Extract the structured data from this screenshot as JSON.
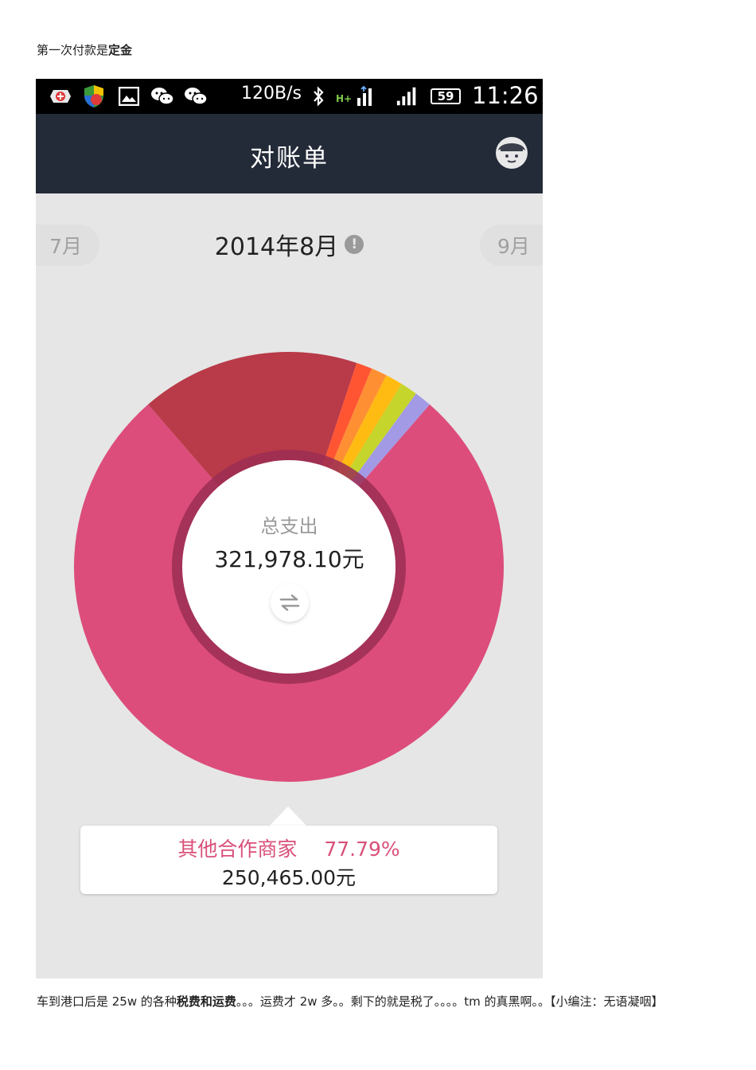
{
  "intro": {
    "text": "第一次付款是",
    "bold": "定金"
  },
  "status_bar": {
    "speed": "120B/s",
    "network": "H+",
    "battery": "59",
    "time": "11:26",
    "icons": [
      "app-icon",
      "security-shield-icon",
      "gallery-icon",
      "wechat-icon",
      "wechat-icon",
      "bluetooth-icon",
      "network-signal-icon",
      "signal-bars-icon",
      "battery-icon"
    ]
  },
  "header": {
    "title": "对账单",
    "avatar_icon": "user-avatar-icon"
  },
  "month_nav": {
    "prev": "7月",
    "current": "2014年8月",
    "next": "9月",
    "info_icon": "!"
  },
  "chart_data": {
    "type": "pie",
    "title": "",
    "slices": [
      {
        "value": 77.79,
        "color": "#dc4d7b",
        "label": "其他合作商家"
      },
      {
        "value": 16.6,
        "color": "#b93a48"
      },
      {
        "value": 1.2,
        "color": "#ff5533"
      },
      {
        "value": 1.2,
        "color": "#ff8f33"
      },
      {
        "value": 1.3,
        "color": "#ffbb11"
      },
      {
        "value": 1.3,
        "color": "#c6d52b"
      },
      {
        "value": 1.3,
        "color": "#a39ae6"
      }
    ],
    "inner_ring_color": "#9b2e53",
    "center_label": "总支出",
    "center_value": "321,978.10元"
  },
  "tooltip": {
    "name": "其他合作商家",
    "percent": "77.79%",
    "amount": "250,465.00元"
  },
  "caption": {
    "p1": "车到港口后是 25w 的各种",
    "b1": "税费和运费",
    "p2": "。。。运费才 2w 多。。剩下的就是税了。。。。tm 的真黑啊。。【小编注：无语凝咽】"
  }
}
